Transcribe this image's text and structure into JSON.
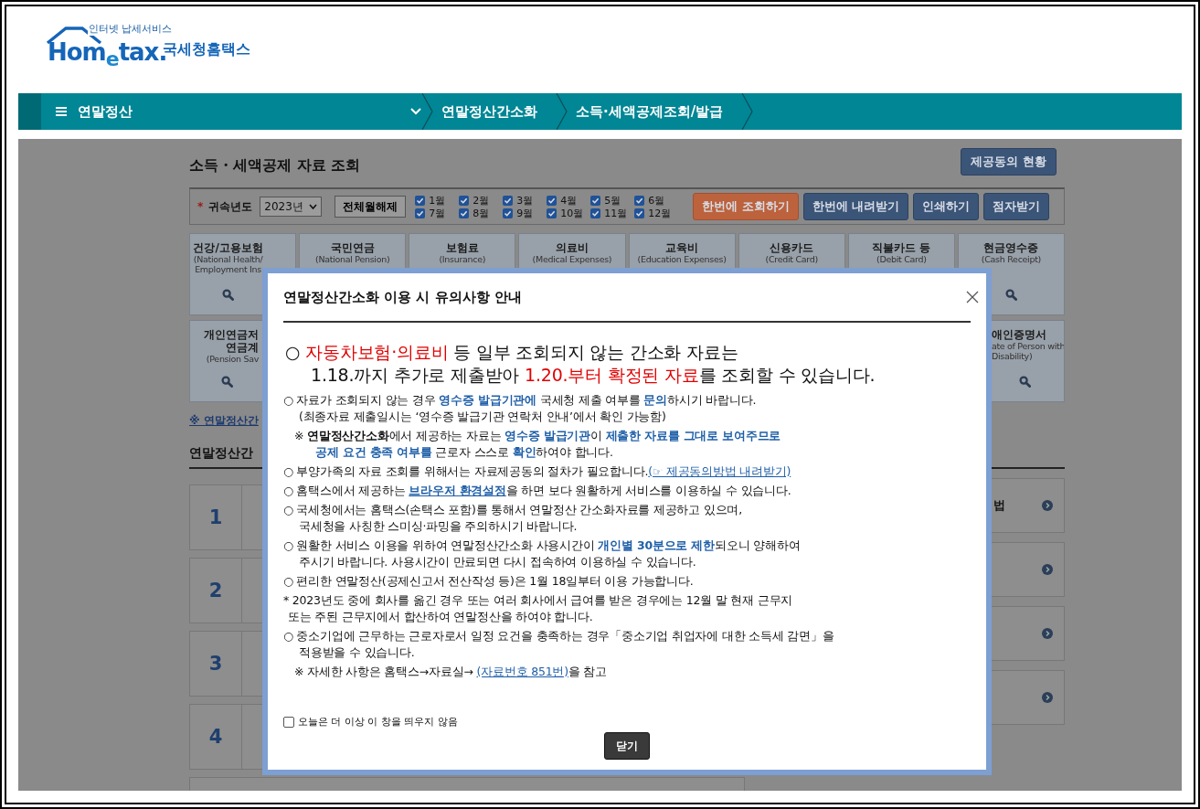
{
  "logo": {
    "wordmark": "Hom$_{e}$tax.",
    "tagline": "인터넷 납세서비스",
    "name": "국세청홈택스"
  },
  "nav": {
    "menu": "연말정산",
    "breadcrumbs": [
      "연말정산간소화",
      "소득·세액공제조회/발급"
    ]
  },
  "page": {
    "title": "소득・세액공제 자료 조회",
    "consent_button": "제공동의 현황"
  },
  "filter": {
    "required_mark": "*",
    "year_label": "귀속년도",
    "year_value": "2023년",
    "clear_button": "전체월해제",
    "months": [
      {
        "label": "1월",
        "checked": true
      },
      {
        "label": "2월",
        "checked": true
      },
      {
        "label": "3월",
        "checked": true
      },
      {
        "label": "4월",
        "checked": true
      },
      {
        "label": "5월",
        "checked": true
      },
      {
        "label": "6월",
        "checked": true
      },
      {
        "label": "7월",
        "checked": true
      },
      {
        "label": "8월",
        "checked": true
      },
      {
        "label": "9월",
        "checked": true
      },
      {
        "label": "10월",
        "checked": true
      },
      {
        "label": "11월",
        "checked": true
      },
      {
        "label": "12월",
        "checked": true
      }
    ],
    "actions": [
      {
        "label": "한번에 조회하기",
        "kind": "primary"
      },
      {
        "label": "한번에 내려받기",
        "kind": "secondary"
      },
      {
        "label": "인쇄하기",
        "kind": "secondary"
      },
      {
        "label": "점자받기",
        "kind": "secondary"
      }
    ]
  },
  "tiles": [
    [
      {
        "title": [
          "건강/고용보험"
        ],
        "subtitle": [
          "(National Health/",
          "Employment Ins"
        ],
        "kind": "edge"
      },
      {
        "title": [
          "국민연금"
        ],
        "subtitle": [
          "(National Pension)"
        ],
        "kind": "full"
      },
      {
        "title": [
          "보험료"
        ],
        "subtitle": [
          "(Insurance)"
        ],
        "kind": "full"
      },
      {
        "title": [
          "의료비"
        ],
        "subtitle": [
          "(Medical Expenses)"
        ],
        "kind": "full"
      },
      {
        "title": [
          "교육비"
        ],
        "subtitle": [
          "(Education Expenses)"
        ],
        "kind": "full"
      },
      {
        "title": [
          "신용카드"
        ],
        "subtitle": [
          "(Credit Card)"
        ],
        "kind": "full"
      },
      {
        "title": [
          "직불카드 등"
        ],
        "subtitle": [
          "(Debit Card)"
        ],
        "kind": "full"
      },
      {
        "title": [
          "현금영수증"
        ],
        "subtitle": [
          "(Cash Receipt)"
        ],
        "kind": "full"
      }
    ],
    [
      {
        "title": [
          "개인연금저",
          "연금계"
        ],
        "subtitle": [
          "(Pension Sav"
        ],
        "kind": "cut-right"
      },
      {
        "title": [
          "애인증명서"
        ],
        "subtitle": [
          "ate of Person with",
          "Disability)"
        ],
        "kind": "cut-left"
      }
    ]
  ],
  "guide_link": "※ 연말정산간",
  "section_title": "연말정산간",
  "steps": [
    "1",
    "2",
    "3",
    "4"
  ],
  "side_cards": [
    {
      "kind": "labeled",
      "label": "법"
    },
    {
      "kind": "icon-only"
    },
    {
      "kind": "icon-only"
    },
    {
      "kind": "icon-only"
    }
  ],
  "modal": {
    "title": "연말정산간소화 이용 시 유의사항 안내",
    "notices": [
      {
        "kind": "big",
        "lines": [
          [
            {
              "text": "○ "
            },
            {
              "text": "자동차보험·의료비",
              "kind": "warning"
            },
            {
              "text": " 등 일부 조회되지 않는 간소화 자료는"
            }
          ],
          [
            {
              "text": "1.18.까지 추가로 제출받아 "
            },
            {
              "text": "1.20.부터 확정된 자료",
              "kind": "warning"
            },
            {
              "text": "를 조회할 수 있습니다."
            }
          ]
        ]
      },
      {
        "kind": "item",
        "lines": [
          [
            {
              "text": "○  자료가 조회되지 않는 경우 "
            },
            {
              "text": "영수증 발급기관에",
              "kind": "highlight"
            },
            {
              "text": " 국세청 제출 여부를 "
            },
            {
              "text": "문의",
              "kind": "highlight"
            },
            {
              "text": "하시기 바랍니다."
            }
          ],
          [
            {
              "text": "(최종자료 제출일시는 ‘영수증 발급기관 연락처 안내’에서 확인 가능함)"
            }
          ]
        ]
      },
      {
        "kind": "note",
        "lines": [
          [
            {
              "text": "※ "
            },
            {
              "text": "연말정산간소화",
              "kind": "strong"
            },
            {
              "text": "에서 제공하는 자료는 "
            },
            {
              "text": "영수증 발급기관",
              "kind": "highlight"
            },
            {
              "text": "이 "
            },
            {
              "text": "제출한 자료를 그대로 보여주므로",
              "kind": "highlight"
            }
          ],
          [
            {
              "text": "공제 요건 충족 여부를",
              "kind": "highlight"
            },
            {
              "text": " 근로자 스스로 "
            },
            {
              "text": "확인",
              "kind": "highlight"
            },
            {
              "text": "하여야 합니다."
            }
          ]
        ]
      },
      {
        "kind": "item",
        "lines": [
          [
            {
              "text": "○ 부양가족의 자료 조회를 위해서는 자료제공동의 절차가 필요합니다."
            },
            {
              "text": "(☞ 제공동의방법 내려받기)",
              "kind": "link"
            }
          ]
        ]
      },
      {
        "kind": "item",
        "lines": [
          [
            {
              "text": "○ 홈택스에서 제공하는 "
            },
            {
              "text": "브라우저 환경설정",
              "kind": "strong-link"
            },
            {
              "text": "을 하면 보다 원활하게 서비스를 이용하실 수 있습니다."
            }
          ]
        ]
      },
      {
        "kind": "item",
        "lines": [
          [
            {
              "text": "○ 국세청에서는 홈택스(손택스 포함)를 통해서 연말정산 간소화자료를 제공하고 있으며,"
            }
          ],
          [
            {
              "text": "국세청을 사칭한 스미싱·파밍을 주의하시기 바랍니다."
            }
          ]
        ]
      },
      {
        "kind": "item",
        "lines": [
          [
            {
              "text": "○ 원활한 서비스 이용을 위하여 연말정산간소화 사용시간이 "
            },
            {
              "text": "개인별 30분으로 제한",
              "kind": "highlight"
            },
            {
              "text": "되오니 양해하여"
            }
          ],
          [
            {
              "text": "주시기 바랍니다. 사용시간이 만료되면 다시 접속하여 이용하실 수 있습니다."
            }
          ]
        ]
      },
      {
        "kind": "item",
        "lines": [
          [
            {
              "text": "○ 편리한 연말정산(공제신고서 전산작성 등)은 1월 18일부터 이용 가능합니다."
            }
          ]
        ]
      },
      {
        "kind": "footnote",
        "lines": [
          [
            {
              "text": "* 2023년도 중에 회사를 옮긴 경우 또는 여러 회사에서 급여를 받은 경우에는 12월 말 현재 근무지"
            }
          ],
          [
            {
              "text": "또는 주된 근무지에서 합산하여 연말정산을 하여야 합니다."
            }
          ]
        ]
      },
      {
        "kind": "item",
        "lines": [
          [
            {
              "text": "○ 중소기업에 근무하는 근로자로서 일정 요건을 충족하는 경우「중소기업 취업자에 대한 소득세 감면」을"
            }
          ],
          [
            {
              "text": "적용받을 수 있습니다."
            }
          ]
        ]
      },
      {
        "kind": "note",
        "lines": [
          [
            {
              "text": "※ 자세한 사항은 홈택스→자료실→ "
            },
            {
              "text": "(자료번호 851번)",
              "kind": "link"
            },
            {
              "text": "을 참고"
            }
          ]
        ]
      }
    ],
    "dont_show": {
      "label": "오늘은 더 이상 이 창을 띄우지 않음",
      "checked": false
    },
    "close_button": "닫기"
  }
}
